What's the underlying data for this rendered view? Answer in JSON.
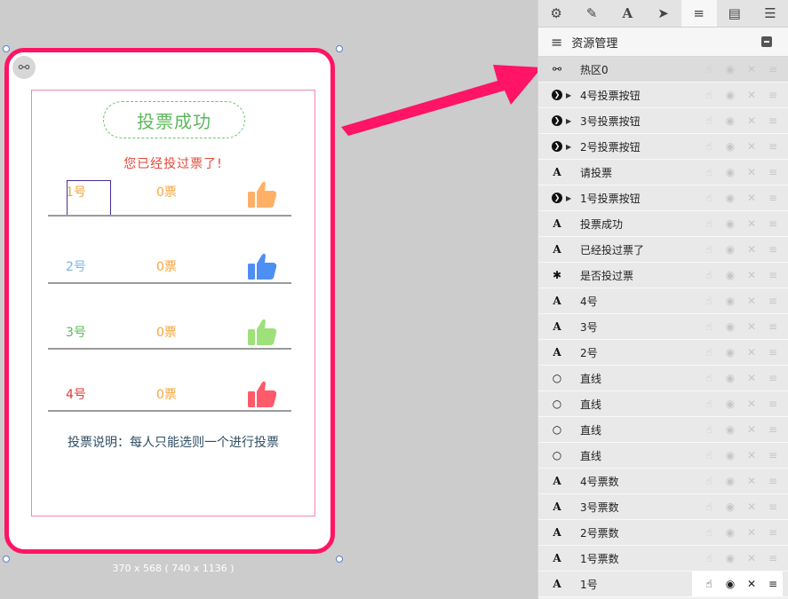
{
  "canvas": {
    "success_title": "投票成功",
    "voted_message": "您已经投过票了!",
    "description": "投票说明：每人只能选则一个进行投票",
    "size_caption": "370 x 568 ( 740 x 1136 )",
    "rows": [
      {
        "num": "1号",
        "count": "0票",
        "num_color": "#f5a53c",
        "thumb_color": "#ffb067"
      },
      {
        "num": "2号",
        "count": "0票",
        "num_color": "#7fb3e6",
        "thumb_color": "#4d8ff5"
      },
      {
        "num": "3号",
        "count": "0票",
        "num_color": "#5cb85c",
        "thumb_color": "#9ee07a"
      },
      {
        "num": "4号",
        "count": "0票",
        "num_color": "#e03a3a",
        "thumb_color": "#ff5a6a"
      }
    ]
  },
  "panel": {
    "tabs": [
      {
        "icon": "gear-icon",
        "glyph": "⚙"
      },
      {
        "icon": "pencil-icon",
        "glyph": "✎"
      },
      {
        "icon": "text-icon",
        "glyph": "A"
      },
      {
        "icon": "send-icon",
        "glyph": "➤"
      },
      {
        "icon": "list-icon",
        "glyph": "≡"
      },
      {
        "icon": "document-icon",
        "glyph": "▤"
      },
      {
        "icon": "database-icon",
        "glyph": "☰"
      }
    ],
    "title": "资源管理",
    "layers": [
      {
        "icon": "link-icon",
        "glyph": "⚯",
        "label": "热区0",
        "group": false,
        "highlight": true
      },
      {
        "icon": "button-icon",
        "glyph": "❯",
        "label": "4号投票按钮",
        "group": true
      },
      {
        "icon": "button-icon",
        "glyph": "❯",
        "label": "3号投票按钮",
        "group": true
      },
      {
        "icon": "button-icon",
        "glyph": "❯",
        "label": "2号投票按钮",
        "group": true
      },
      {
        "icon": "text-icon",
        "glyph": "A",
        "label": "请投票",
        "group": false
      },
      {
        "icon": "button-icon",
        "glyph": "❯",
        "label": "1号投票按钮",
        "group": true
      },
      {
        "icon": "text-icon",
        "glyph": "A",
        "label": "投票成功",
        "group": false
      },
      {
        "icon": "text-icon",
        "glyph": "A",
        "label": "已经投过票了",
        "group": false
      },
      {
        "icon": "asterisk-icon",
        "glyph": "✱",
        "label": "是否投过票",
        "group": false
      },
      {
        "icon": "text-icon",
        "glyph": "A",
        "label": "4号",
        "group": false
      },
      {
        "icon": "text-icon",
        "glyph": "A",
        "label": "3号",
        "group": false
      },
      {
        "icon": "text-icon",
        "glyph": "A",
        "label": "2号",
        "group": false
      },
      {
        "icon": "circle-icon",
        "glyph": "○",
        "label": "直线",
        "group": false
      },
      {
        "icon": "circle-icon",
        "glyph": "○",
        "label": "直线",
        "group": false
      },
      {
        "icon": "circle-icon",
        "glyph": "○",
        "label": "直线",
        "group": false
      },
      {
        "icon": "circle-icon",
        "glyph": "○",
        "label": "直线",
        "group": false
      },
      {
        "icon": "text-icon",
        "glyph": "A",
        "label": "4号票数",
        "group": false
      },
      {
        "icon": "text-icon",
        "glyph": "A",
        "label": "3号票数",
        "group": false
      },
      {
        "icon": "text-icon",
        "glyph": "A",
        "label": "2号票数",
        "group": false
      },
      {
        "icon": "text-icon",
        "glyph": "A",
        "label": "1号票数",
        "group": false
      },
      {
        "icon": "text-icon",
        "glyph": "A",
        "label": "1号",
        "group": false,
        "active": true
      }
    ],
    "row_actions": [
      {
        "icon": "hand-icon",
        "glyph": "☝"
      },
      {
        "icon": "eye-icon",
        "glyph": "◉"
      },
      {
        "icon": "close-icon",
        "glyph": "✕"
      },
      {
        "icon": "menu-icon",
        "glyph": "≡"
      }
    ],
    "accent_color": "#ff1466"
  }
}
